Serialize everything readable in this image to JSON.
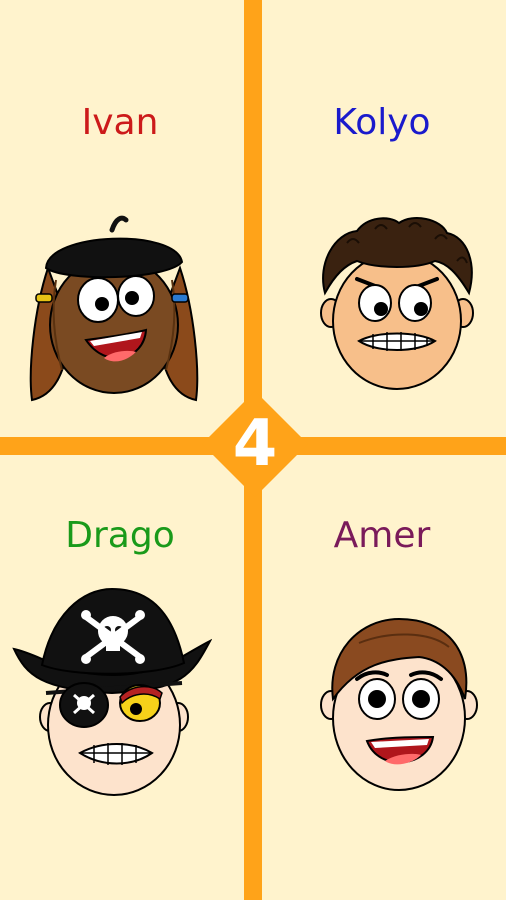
{
  "round": {
    "number": "4"
  },
  "colors": {
    "background": "#fff3cd",
    "divider": "#ffa319",
    "badge_text": "#ffffff"
  },
  "players": [
    {
      "name": "Ivan",
      "color": "#cc1a1a",
      "avatar": "girl-with-beret-avatar"
    },
    {
      "name": "Kolyo",
      "color": "#1a1acc",
      "avatar": "curly-hair-boy-avatar"
    },
    {
      "name": "Drago",
      "color": "#1a9a1a",
      "avatar": "pirate-avatar"
    },
    {
      "name": "Amer",
      "color": "#7a1a5a",
      "avatar": "brown-hair-boy-avatar"
    }
  ]
}
